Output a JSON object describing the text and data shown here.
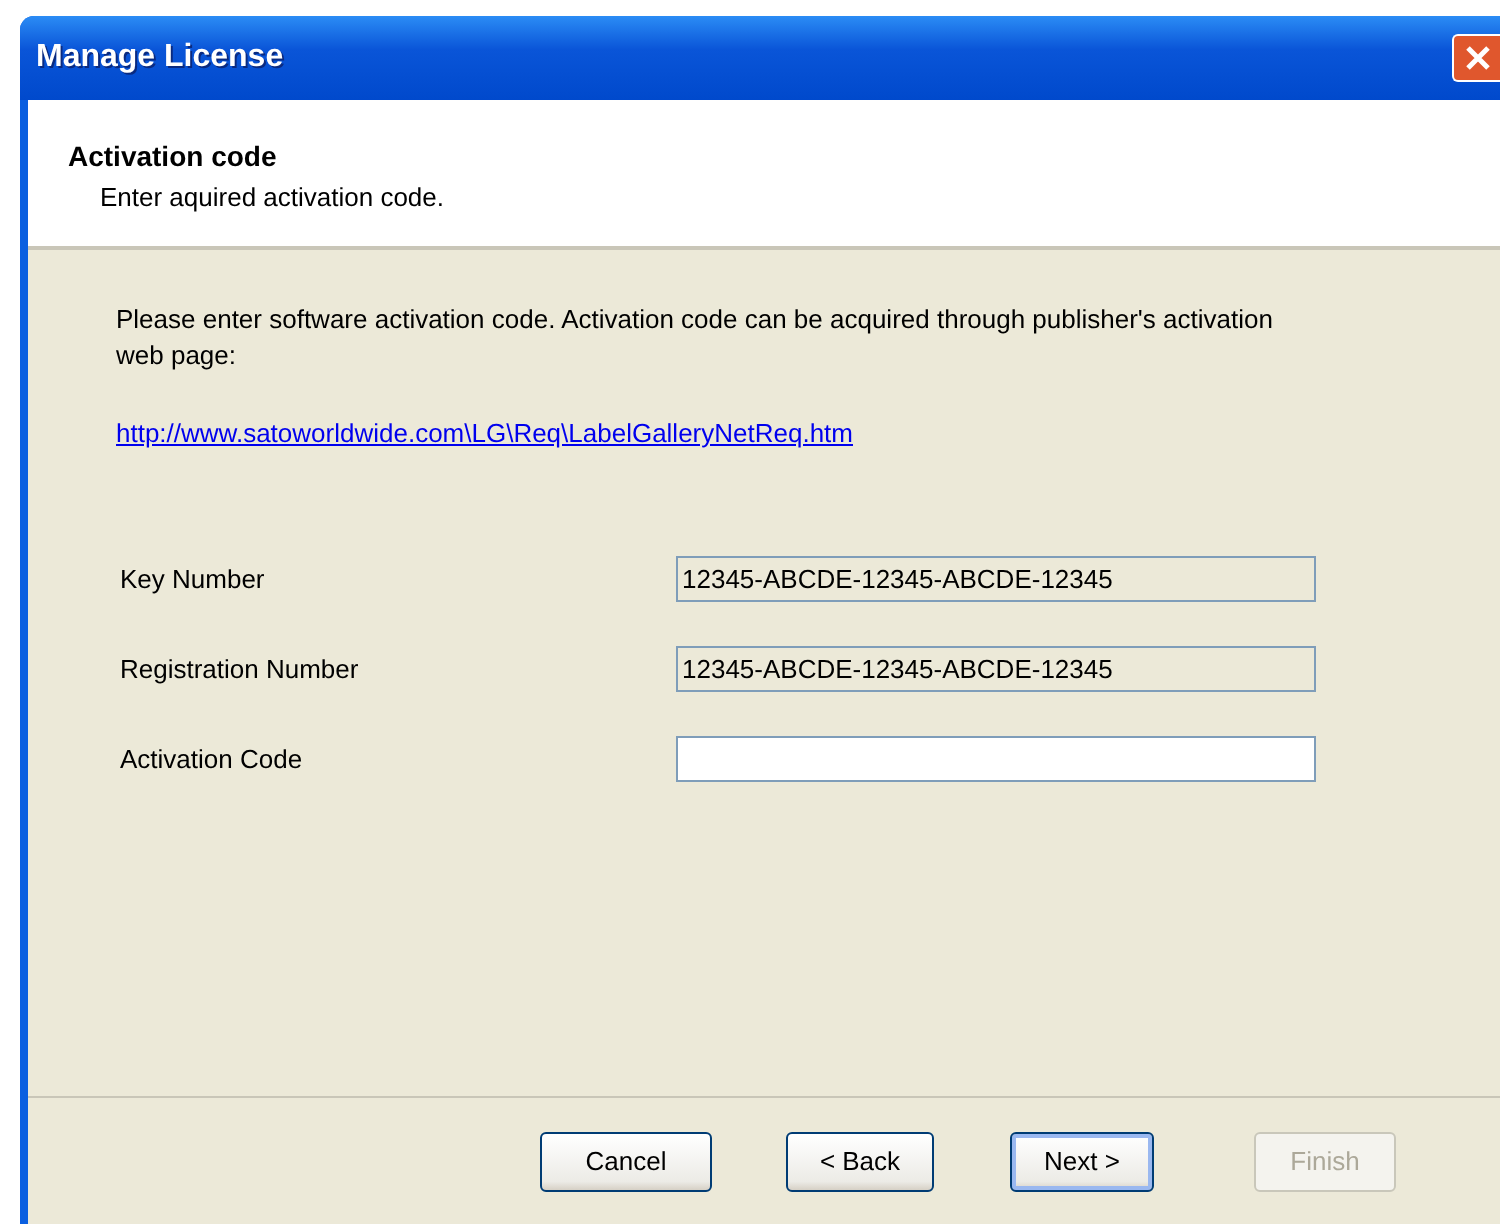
{
  "window": {
    "title": "Manage License"
  },
  "header": {
    "title": "Activation code",
    "subtitle": "Enter aquired activation code."
  },
  "intro": "Please enter software activation code. Activation code can be acquired through publisher's activation web page:",
  "link": "http://www.satoworldwide.com\\LG\\Req\\LabelGalleryNetReq.htm",
  "fields": [
    {
      "label": "Key Number",
      "value": "12345-ABCDE-12345-ABCDE-12345",
      "disabled": true
    },
    {
      "label": "Registration Number",
      "value": "12345-ABCDE-12345-ABCDE-12345",
      "disabled": true
    },
    {
      "label": "Activation Code",
      "disabled": false
    }
  ],
  "buttons": [
    {
      "label": "Cancel",
      "default": false,
      "disabled": false
    },
    {
      "label": "< Back",
      "default": false,
      "disabled": false
    },
    {
      "label": "Next >",
      "default": true,
      "disabled": false
    },
    {
      "label": "Finish",
      "default": false,
      "disabled": true
    }
  ]
}
